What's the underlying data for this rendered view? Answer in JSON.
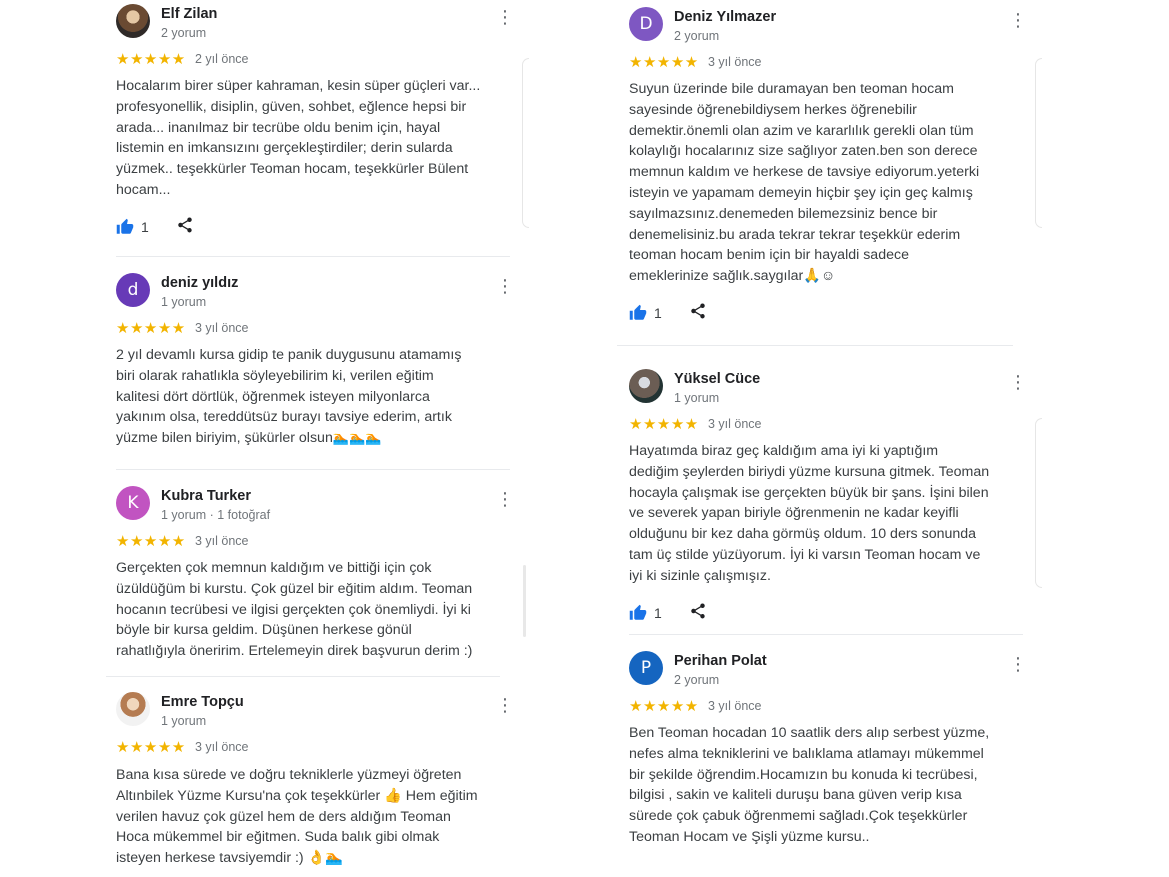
{
  "reviews": [
    {
      "name": "Elf Zilan",
      "meta": "2 yorum",
      "stars": "★★★★★",
      "date": "2 yıl önce",
      "text": "Hocalarım birer süper kahraman, kesin süper güçleri var...\nprofesyonellik, disiplin, güven, sohbet, eğlence hepsi bir\narada... inanılmaz bir tecrübe oldu benim için, hayal\nlistemin en imkansızını gerçekleştirdiler; derin sularda\nyüzmek.. teşekkürler Teoman hocam, teşekkürler Bülent\nhocam...",
      "likes": "1"
    },
    {
      "initial": "d",
      "name": "deniz yıldız",
      "meta": "1 yorum",
      "stars": "★★★★★",
      "date": "3 yıl önce",
      "text": "2 yıl devamlı kursa gidip te panik duygusunu atamamış\nbiri olarak rahatlıkla söyleyebilirim ki, verilen eğitim\nkalitesi dört dörtlük, öğrenmek isteyen milyonlarca\nyakınım olsa, tereddütsüz burayı tavsiye ederim, artık\nyüzme bilen biriyim, şükürler olsun",
      "emoji": "🏊🏊🏊"
    },
    {
      "initial": "K",
      "name": "Kubra Turker",
      "meta": "1 yorum · 1 fotoğraf",
      "stars": "★★★★★",
      "date": "3 yıl önce",
      "text": "Gerçekten çok memnun kaldığım ve bittiği için çok\nüzüldüğüm bi kurstu. Çok güzel bir eğitim  aldım. Teoman\nhocanın tecrübesi ve ilgisi gerçekten çok önemliydi. İyi ki\nböyle bir kursa geldim. Düşünen herkese gönül\nrahatlığıyla öneririm. Ertelemeyin direk başvurun derim :)"
    },
    {
      "name": "Emre Topçu",
      "meta": "1 yorum",
      "stars": "★★★★★",
      "date": "3 yıl önce",
      "text": "Bana kısa sürede ve doğru tekniklerle yüzmeyi öğreten\nAltınbilek Yüzme Kursu'na çok teşekkürler 👍 Hem eğitim\nverilen havuz çok güzel hem de ders aldığım Teoman\nHoca mükemmel bir eğitmen. Suda balık gibi olmak\nisteyen herkese tavsiyemdir :) 👌🏊"
    },
    {
      "initial": "D",
      "name": "Deniz Yılmazer",
      "meta": "2 yorum",
      "stars": "★★★★★",
      "date": "3 yıl önce",
      "text": "Suyun üzerinde bile duramayan ben teoman hocam\nsayesinde öğrenebildiysem herkes öğrenebilir\ndemektir.önemli olan azim ve kararlılık gerekli olan tüm\nkolaylığı hocalarınız size sağlıyor zaten.ben son derece\nmemnun kaldım ve herkese de tavsiye ediyorum.yeterki\nisteyin ve yapamam demeyin hiçbir şey için geç kalmış\nsayılmazsınız.denemeden bilemezsiniz bence bir\ndenemelisiniz.bu arada tekrar tekrar teşekkür ederim\nteoman hocam benim için bir hayaldi sadece\nemeklerinize sağlık.saygılar🙏☺",
      "likes": "1"
    },
    {
      "name": "Yüksel Cüce",
      "meta": "1 yorum",
      "stars": "★★★★★",
      "date": "3 yıl önce",
      "text": "Hayatımda biraz geç kaldığım ama iyi ki yaptığım\ndediğim şeylerden biriydi yüzme kursuna gitmek. Teoman\nhocayla çalışmak ise gerçekten büyük bir şans. İşini bilen\nve severek yapan biriyle öğrenmenin ne kadar keyifli\nolduğunu bir kez daha görmüş oldum. 10 ders sonunda\ntam üç stilde yüzüyorum. İyi ki varsın Teoman hocam ve\niyi ki sizinle çalışmışız.",
      "likes": "1"
    },
    {
      "initial": "P",
      "name": "Perihan Polat",
      "meta": "2 yorum",
      "stars": "★★★★★",
      "date": "3 yıl önce",
      "text": "Ben Teoman hocadan 10 saatlik ders alıp serbest yüzme,\nnefes alma tekniklerini ve balıklama atlamayı mükemmel\nbir şekilde öğrendim.Hocamızın bu konuda ki tecrübesi,\nbilgisi , sakin ve kaliteli duruşu  bana güven verip kısa\nsürede çok çabuk öğrenmemi sağladı.Çok teşekkürler\nTeoman Hocam ve Şişli yüzme kursu.."
    }
  ],
  "more_icon": "⋮",
  "colors": {
    "star": "#f2b400",
    "like": "#1a73e8",
    "avatar_d": "#673ab7",
    "avatar_K": "#c154c1",
    "avatar_D": "#7e57c2",
    "avatar_P": "#1565c0"
  }
}
